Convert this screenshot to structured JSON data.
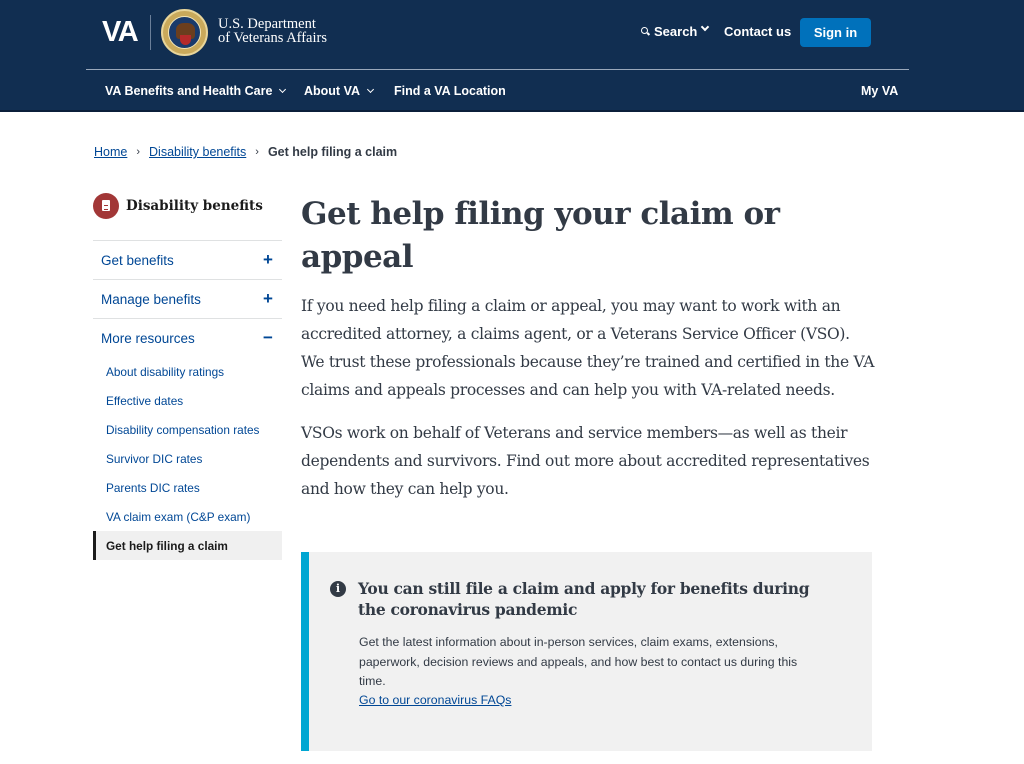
{
  "header": {
    "logo_text": "VA",
    "department_line1": "U.S. Department",
    "department_line2": "of Veterans Affairs",
    "search_label": "Search",
    "contact_label": "Contact us",
    "sign_in_label": "Sign in",
    "nav": [
      {
        "label": "VA Benefits and Health Care",
        "has_dropdown": true
      },
      {
        "label": "About VA",
        "has_dropdown": true
      },
      {
        "label": "Find a VA Location",
        "has_dropdown": false
      },
      {
        "label": "My VA",
        "has_dropdown": false
      }
    ]
  },
  "breadcrumb": {
    "items": [
      {
        "label": "Home",
        "link": true
      },
      {
        "label": "Disability benefits",
        "link": true
      },
      {
        "label": "Get help filing a claim",
        "link": false
      }
    ],
    "separator": "›"
  },
  "sidebar": {
    "title": "Disability benefits",
    "icon": "document-icon",
    "sections": [
      {
        "label": "Get benefits",
        "toggle": "+",
        "expanded": false
      },
      {
        "label": "Manage benefits",
        "toggle": "+",
        "expanded": false
      },
      {
        "label": "More resources",
        "toggle": "−",
        "expanded": true
      }
    ],
    "subitems": [
      {
        "label": "About disability ratings",
        "active": false
      },
      {
        "label": "Effective dates",
        "active": false
      },
      {
        "label": "Disability compensation rates",
        "active": false
      },
      {
        "label": "Survivor DIC rates",
        "active": false
      },
      {
        "label": "Parents DIC rates",
        "active": false
      },
      {
        "label": "VA claim exam (C&P exam)",
        "active": false
      },
      {
        "label": "Get help filing a claim",
        "active": true
      }
    ]
  },
  "main": {
    "title": "Get help filing your claim or appeal",
    "paragraphs": [
      "If you need help filing a claim or appeal, you may want to work with an accredited attorney, a claims agent, or a Veterans Service Officer (VSO). We trust these professionals because they’re trained and certified in the VA claims and appeals processes and can help you with VA-related needs.",
      "VSOs work on behalf of Veterans and service members—as well as their dependents and survivors. Find out more about accredited representatives and how they can help you."
    ],
    "alert": {
      "icon": "info-icon",
      "icon_glyph": "i",
      "title": "You can still file a claim and apply for benefits during the coronavirus pandemic",
      "body": "Get the latest information about in-person services, claim exams, extensions, paperwork, decision reviews and appeals, and how best to contact us during this time.",
      "link_label": "Go to our coronavirus FAQs"
    }
  },
  "colors": {
    "header_bg": "#112e51",
    "primary_button": "#0071bb",
    "link": "#004795",
    "alert_accent": "#00a6d2",
    "alert_bg": "#f1f1f1",
    "sidebar_icon_bg": "#a23737",
    "text_dark": "#323a45"
  }
}
